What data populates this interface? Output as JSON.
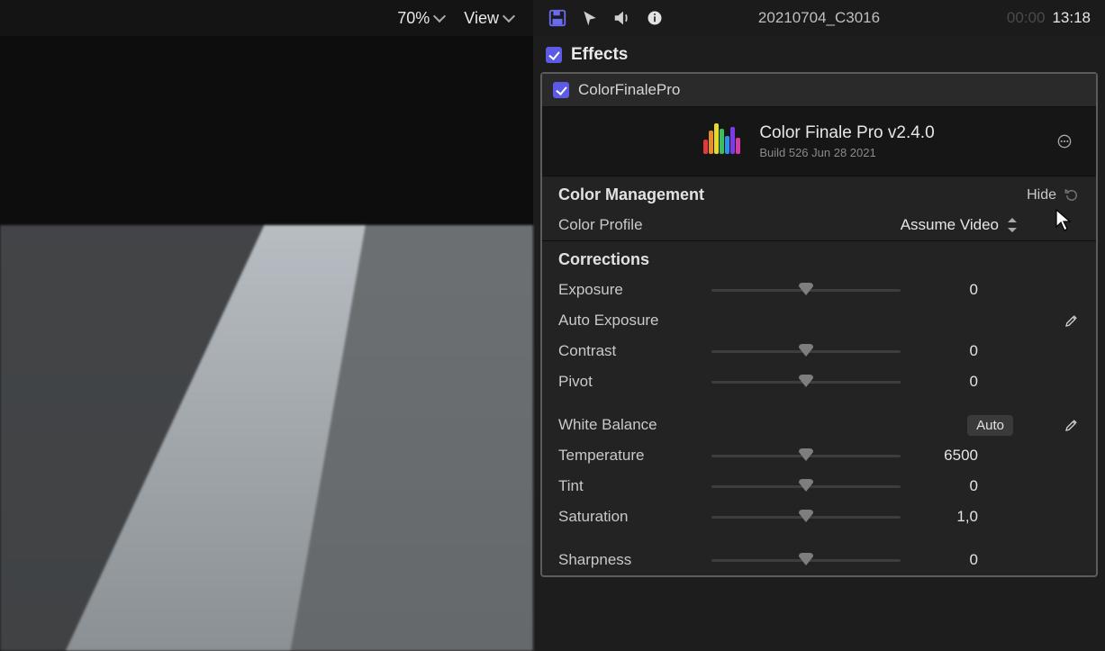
{
  "viewer": {
    "zoom": "70%",
    "view_label": "View"
  },
  "header": {
    "clip_name": "20210704_C3016",
    "time_dim": "00:00",
    "time": "13:18",
    "icons": [
      "save-icon",
      "cursor-icon",
      "speaker-icon",
      "info-icon"
    ]
  },
  "effects": {
    "section_label": "Effects",
    "plugin_name": "ColorFinalePro",
    "plugin_title": "Color Finale Pro v2.4.0",
    "plugin_build": "Build 526 Jun 28 2021"
  },
  "color_management": {
    "title": "Color Management",
    "hide_label": "Hide",
    "profile_label": "Color Profile",
    "profile_value": "Assume Video"
  },
  "corrections": {
    "title": "Corrections",
    "exposure_label": "Exposure",
    "exposure_value": "0",
    "auto_exposure_label": "Auto Exposure",
    "contrast_label": "Contrast",
    "contrast_value": "0",
    "pivot_label": "Pivot",
    "pivot_value": "0",
    "wb_label": "White Balance",
    "auto_label": "Auto",
    "temperature_label": "Temperature",
    "temperature_value": "6500",
    "tint_label": "Tint",
    "tint_value": "0",
    "saturation_label": "Saturation",
    "saturation_value": "1,0",
    "sharpness_label": "Sharpness",
    "sharpness_value": "0"
  }
}
